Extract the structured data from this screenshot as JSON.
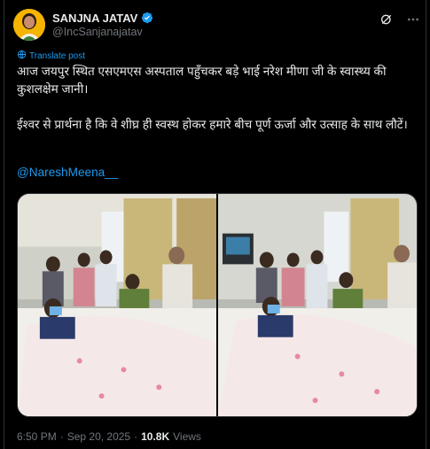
{
  "author": {
    "name": "SANJNA JATAV",
    "handle": "@IncSanjanajatav"
  },
  "icons": {
    "verified": "verified-badge-icon",
    "grok": "grok-icon",
    "more": "more-options-icon",
    "translate": "globe-icon"
  },
  "colors": {
    "accent": "#1d9bf0",
    "muted": "#71767b",
    "text": "#e7e9ea"
  },
  "tweet": {
    "translate_label": "Translate post",
    "text": "आज जयपुर स्थित एसएमएस अस्पताल पहुँचकर बड़े भाई नरेश मीणा जी के स्वास्थ्य की कुशलक्षेम जानी।\n\nईश्वर से प्रार्थना है कि वे शीघ्र ही स्वस्थ होकर हमारे बीच पूर्ण ऊर्जा और उत्साह के साथ लौटें।",
    "mention": "@NareshMeena__"
  },
  "meta": {
    "time": "6:50 PM",
    "separator": "·",
    "date": "Sep 20, 2025",
    "views_count": "10.8K",
    "views_label": "Views"
  }
}
